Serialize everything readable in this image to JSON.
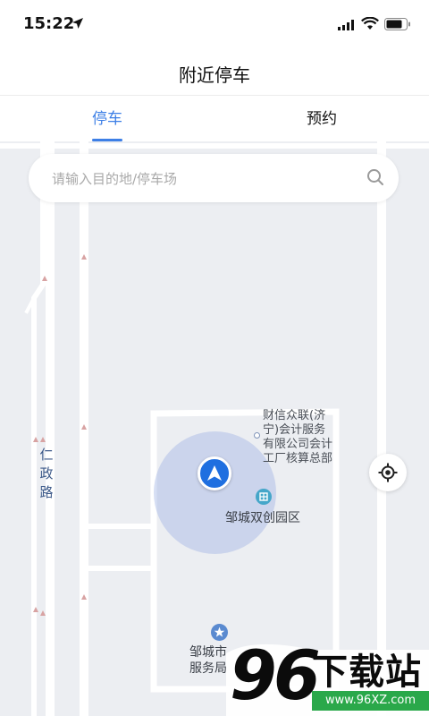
{
  "status_bar": {
    "time": "15:22"
  },
  "nav": {
    "title": "附近停车"
  },
  "tabs": [
    {
      "label": "停车",
      "active": true
    },
    {
      "label": "预约",
      "active": false
    }
  ],
  "search": {
    "placeholder": "请输入目的地/停车场",
    "value": ""
  },
  "map": {
    "road_label": [
      "仁",
      "政",
      "路"
    ],
    "poi_company": [
      "财信众联(济",
      "宁)会计服务",
      "有限公司会计",
      "工厂核算总部"
    ],
    "poi_park": "邹城双创园区",
    "poi_gov": [
      "邹城市",
      "服务局"
    ]
  },
  "watermark": {
    "number": "96",
    "text": "下载站",
    "url": "www.96XZ.com"
  },
  "colors": {
    "accent": "#3d7fe6",
    "map_bg": "#eceef2",
    "road": "#ffffff"
  }
}
